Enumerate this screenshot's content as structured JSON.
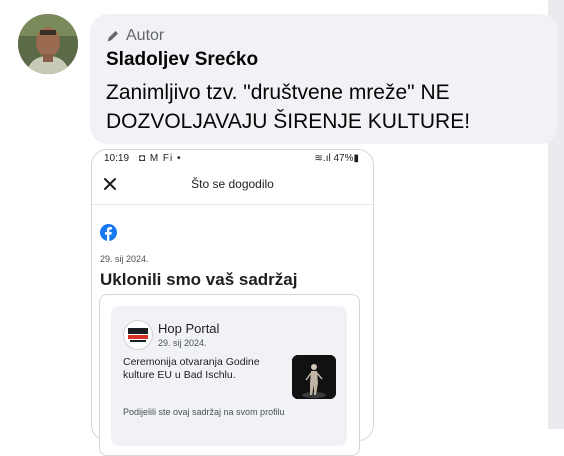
{
  "comment": {
    "author_badge": "Autor",
    "author_name": "Sladoljev Srećko",
    "text": "Zanimljivo tzv. \"društvene mreže\" NE DOZVOLJAVAJU  ŠIRENJE KULTURE!"
  },
  "attachment": {
    "status_bar": {
      "time": "10:19",
      "icons": "◘ M Fi •",
      "right": "≋.ıl 47%▮"
    },
    "header_title": "Što se dogodilo",
    "post_date": "29. sij 2024.",
    "removed_title": "Uklonili smo vaš sadržaj",
    "card": {
      "page_name": "Hop Portal",
      "page_date": "29. sij 2024.",
      "text": "Ceremonija otvaranja Godine kulture EU u Bad Ischlu.",
      "shared_note": "Podijelili ste ovaj sadržaj na svom profilu"
    }
  },
  "colors": {
    "bubble": "#f0f2f5",
    "facebook_blue": "#1877f2",
    "text": "#050505",
    "secondary_text": "#65676b"
  }
}
